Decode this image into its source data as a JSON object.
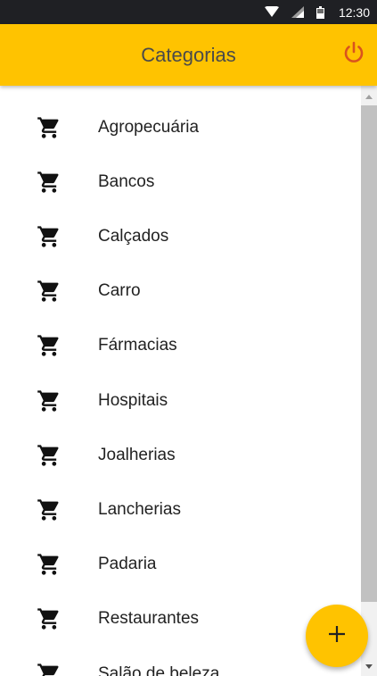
{
  "status_bar": {
    "time": "12:30",
    "icons": [
      "wifi-icon",
      "signal-icon",
      "battery-icon"
    ]
  },
  "app_bar": {
    "title": "Categorias",
    "logout_icon": "power-icon"
  },
  "categories": [
    {
      "label": "Agropecuária",
      "icon": "cart-icon"
    },
    {
      "label": "Bancos",
      "icon": "cart-icon"
    },
    {
      "label": "Calçados",
      "icon": "cart-icon"
    },
    {
      "label": "Carro",
      "icon": "cart-icon"
    },
    {
      "label": "Fármacias",
      "icon": "cart-icon"
    },
    {
      "label": "Hospitais",
      "icon": "cart-icon"
    },
    {
      "label": "Joalherias",
      "icon": "cart-icon"
    },
    {
      "label": "Lancherias",
      "icon": "cart-icon"
    },
    {
      "label": "Padaria",
      "icon": "cart-icon"
    },
    {
      "label": "Restaurantes",
      "icon": "cart-icon"
    },
    {
      "label": "Salão de beleza",
      "icon": "cart-icon"
    }
  ],
  "fab": {
    "icon": "plus-icon"
  },
  "colors": {
    "accent": "#ffc300",
    "power_icon": "#d9531e",
    "status_bar": "#1f2024"
  }
}
